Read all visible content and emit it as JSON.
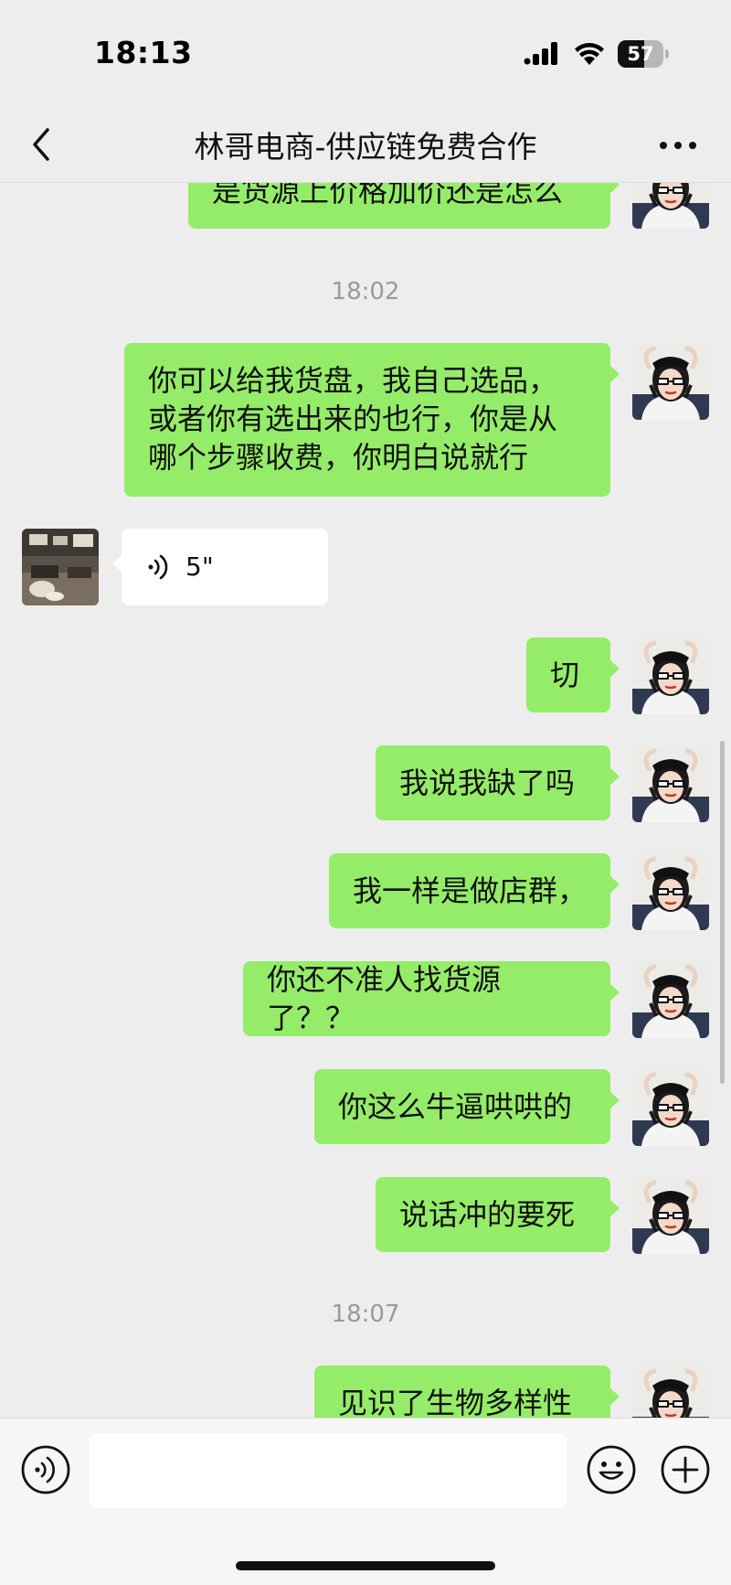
{
  "status_bar": {
    "time": "18:13",
    "battery_level": "57",
    "battery_fraction": 0.57,
    "icons": [
      "signal-icon",
      "wifi-icon",
      "battery-icon"
    ]
  },
  "nav": {
    "title": "林哥电商-供应链免费合作",
    "back_icon": "chevron-left-icon",
    "more_icon": "more-icon"
  },
  "colors": {
    "background": "#ededed",
    "outgoing_bubble": "#95ec69",
    "incoming_bubble": "#ffffff",
    "timestamp_text": "#9a9a9a"
  },
  "messages": [
    {
      "direction": "out",
      "text": "是货源上价格加价还是怎么"
    },
    {
      "type": "timestamp",
      "text": "18:02"
    },
    {
      "direction": "out",
      "lines": [
        "你可以给我货盘，我自己选品，",
        "或者你有选出来的也行，你是从",
        "哪个步骤收费，你明白说就行"
      ]
    },
    {
      "direction": "in",
      "type": "voice",
      "duration": "5\""
    },
    {
      "direction": "out",
      "text": "切"
    },
    {
      "direction": "out",
      "text": "我说我缺了吗"
    },
    {
      "direction": "out",
      "text": "我一样是做店群，"
    },
    {
      "direction": "out",
      "text": "你还不准人找货源了？？"
    },
    {
      "direction": "out",
      "text": "你这么牛逼哄哄的"
    },
    {
      "direction": "out",
      "text": "说话冲的要死"
    },
    {
      "type": "timestamp",
      "text": "18:07"
    },
    {
      "direction": "out",
      "text": "见识了生物多样性"
    }
  ],
  "input_bar": {
    "voice_icon": "voice-mode-icon",
    "input_value": "",
    "emoji_icon": "emoji-icon",
    "plus_icon": "plus-icon"
  }
}
